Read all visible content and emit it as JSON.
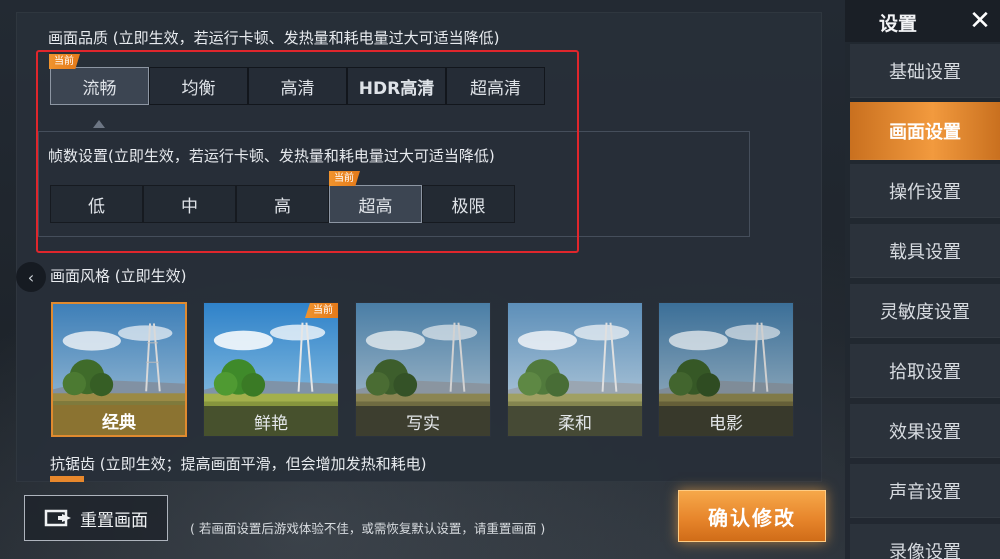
{
  "quality": {
    "title": "画面品质 (立即生效，若运行卡顿、发热量和耗电量过大可适当降低)",
    "options": [
      "流畅",
      "均衡",
      "高清",
      "HDR高清",
      "超高清"
    ],
    "selected_index": 0,
    "badge": "当前"
  },
  "framerate": {
    "title": "帧数设置(立即生效，若运行卡顿、发热量和耗电量过大可适当降低)",
    "options": [
      "低",
      "中",
      "高",
      "超高",
      "极限"
    ],
    "selected_index": 3,
    "badge": "当前"
  },
  "style": {
    "title": "画面风格 (立即生效)",
    "options": [
      "经典",
      "鲜艳",
      "写实",
      "柔和",
      "电影"
    ],
    "selected_index": 0,
    "current_index": 1,
    "badge": "当前"
  },
  "antialias": {
    "title": "抗锯齿 (立即生效；提高画面平滑，但会增加发热和耗电)"
  },
  "footer": {
    "reset_label": "重置画面",
    "reset_note": "( 若画面设置后游戏体验不佳，或需恢复默认设置，请重置画面 )",
    "confirm_label": "确认修改"
  },
  "sidebar": {
    "title": "设置",
    "items": [
      {
        "label": "基础设置"
      },
      {
        "label": "画面设置",
        "active": true
      },
      {
        "label": "操作设置"
      },
      {
        "label": "载具设置"
      },
      {
        "label": "灵敏度设置"
      },
      {
        "label": "拾取设置"
      },
      {
        "label": "效果设置"
      },
      {
        "label": "声音设置"
      },
      {
        "label": "录像设置"
      }
    ]
  },
  "colors": {
    "accent": "#e8882c",
    "highlight_frame": "#e0262c"
  }
}
